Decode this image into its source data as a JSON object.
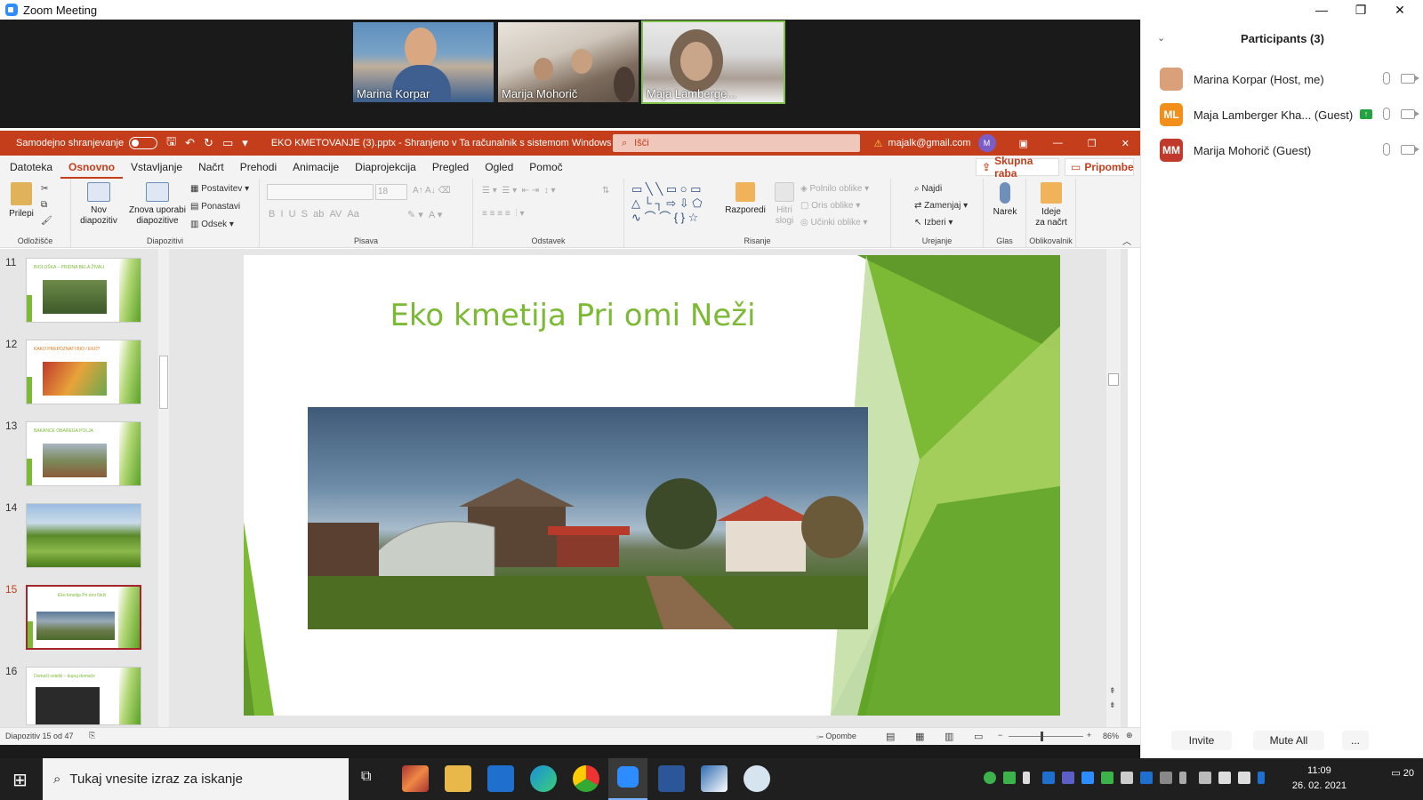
{
  "zoom": {
    "window_title": "Zoom Meeting",
    "tiles": [
      "Marina Korpar",
      "Marija Mohorič",
      "Maja Lamberge..."
    ],
    "participants_title": "Participants (3)",
    "participants": [
      {
        "initials": "",
        "name": "Marina Korpar (Host, me)",
        "avatar_color": "#d9a07a"
      },
      {
        "initials": "ML",
        "name": "Maja Lamberger Kha... (Guest)",
        "avatar_color": "#f28f1a"
      },
      {
        "initials": "MM",
        "name": "Marija Mohorič (Guest)",
        "avatar_color": "#c0392b"
      }
    ],
    "invite": "Invite",
    "mute_all": "Mute All",
    "more": "..."
  },
  "ppt": {
    "autosave": "Samodejno shranjevanje",
    "doc_title": "EKO KMETOVANJE (3).pptx - Shranjeno v Ta računalnik s sistemom Windows",
    "search_placeholder": "Išči",
    "user_email": "majalk@gmail.com",
    "user_initial": "M",
    "accent": "#c43e1c",
    "menu": [
      "Datoteka",
      "Osnovno",
      "Vstavljanje",
      "Načrt",
      "Prehodi",
      "Animacije",
      "Diaprojekcija",
      "Pregled",
      "Ogled",
      "Pomoč"
    ],
    "share_btn": "Skupna raba",
    "comments_btn": "Pripombe",
    "ribbon": {
      "paste": "Prilepi",
      "new_slide": "Nov\ndiapozitiv",
      "reuse": "Znova uporabi\ndiapozitive",
      "layout": "Postavitev",
      "reset": "Ponastavi",
      "section": "Odsek",
      "font_size": "18",
      "arrange": "Razporedi",
      "quick_styles": "Hitri\nslogi",
      "shape_fill": "Polnilo oblike",
      "shape_outline": "Oris oblike",
      "shape_effects": "Učinki oblike",
      "find": "Najdi",
      "replace": "Zamenjaj",
      "select": "Izberi",
      "dictate": "Narek",
      "designer": "Ideje\nza načrt",
      "groups": [
        "Odložišče",
        "Diapozitivi",
        "Pisava",
        "Odstavek",
        "Risanje",
        "Urejanje",
        "Glas",
        "Oblikovalnik"
      ]
    },
    "thumbnails": [
      {
        "num": "11",
        "title": "BIOLOŠKA – PRIDNA BELA ŽIVALI"
      },
      {
        "num": "12",
        "title": "KAKO PREPOZNATI BIO / EKO?"
      },
      {
        "num": "13",
        "title": "BAKANCE OBAREGA POLJA"
      },
      {
        "num": "14",
        "title": ""
      },
      {
        "num": "15",
        "title": "Eko kmetija Pri omi Neži"
      },
      {
        "num": "16",
        "title": "Domači izdelki – kupuj domače"
      }
    ],
    "slide_title": "Eko kmetija Pri omi Neži",
    "status_slide": "Diapozitiv 15 od 47",
    "notes": "Opombe",
    "zoom_pct": "86%"
  },
  "taskbar": {
    "search_placeholder": "Tukaj vnesite izraz za iskanje",
    "time": "11:09",
    "date": "26. 02. 2021",
    "notifications": "20"
  }
}
